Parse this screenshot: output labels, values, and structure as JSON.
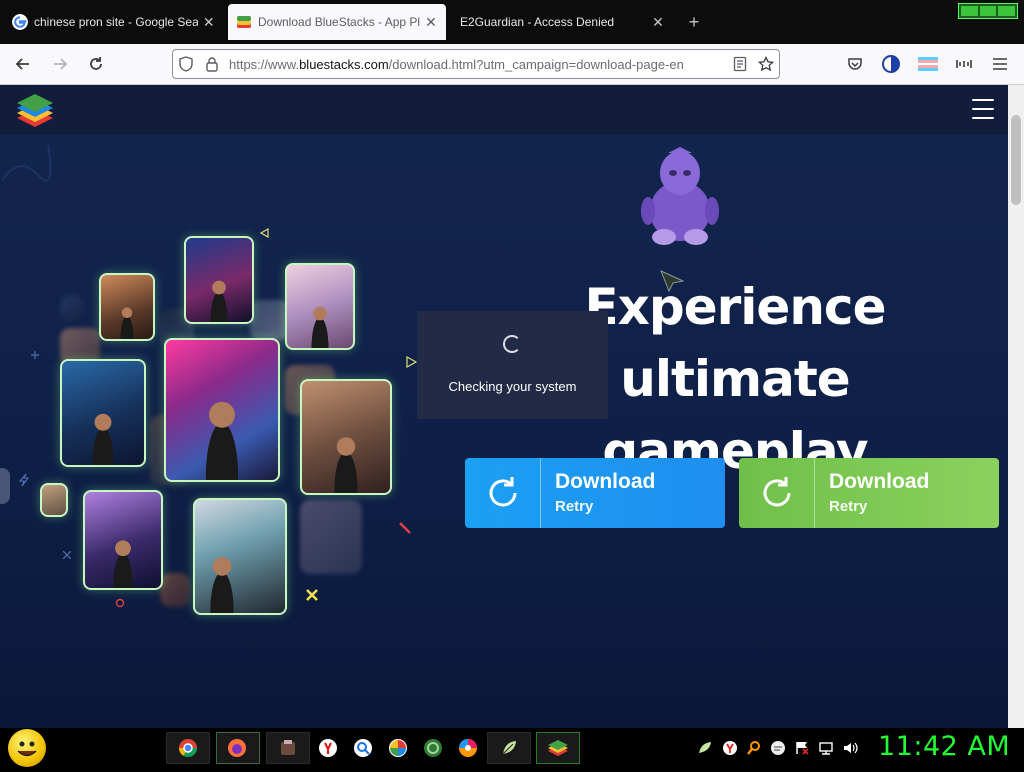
{
  "browser": {
    "tabs": [
      {
        "title": "chinese pron site - Google Search",
        "active": false,
        "favicon": "google-g-icon"
      },
      {
        "title": "Download BlueStacks - App Player",
        "active": true,
        "favicon": "bluestacks-icon"
      },
      {
        "title": "E2Guardian - Access Denied",
        "active": false,
        "favicon": ""
      }
    ],
    "new_tab_glyph": "+",
    "close_glyph": "✕",
    "url": {
      "prefix": "https://www.",
      "domain": "bluestacks.com",
      "rest": "/download.html?utm_campaign=download-page-en"
    }
  },
  "page": {
    "heading_line1": "Experience ultimate",
    "heading_line2": "gameplay",
    "download_buttons": [
      {
        "label": "Download",
        "sub_label": "Retry",
        "color": "#1f97f2"
      },
      {
        "label": "Download",
        "sub_label": "Retry",
        "color": "#7cc853"
      }
    ],
    "checking_overlay": {
      "message": "Checking your system"
    }
  },
  "taskbar": {
    "clock": "11:42 AM",
    "clock_color": "#22ff33"
  },
  "colors": {
    "page_bg": "#13264e",
    "site_header_bg": "#111d3a",
    "photo_glow": "#c9f5c0"
  }
}
